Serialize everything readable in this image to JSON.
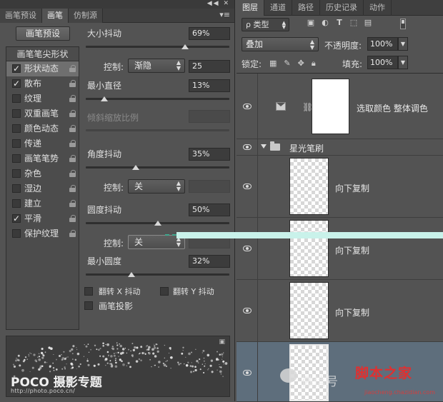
{
  "brush_panel": {
    "tabs": [
      "画笔预设",
      "画笔",
      "仿制源"
    ],
    "active_tab": 1,
    "preset_button": "画笔预设",
    "list_header": "画笔笔尖形状",
    "items": [
      {
        "label": "形状动态",
        "checked": true,
        "selected": true
      },
      {
        "label": "散布",
        "checked": true,
        "selected": false
      },
      {
        "label": "纹理",
        "checked": false,
        "selected": false
      },
      {
        "label": "双重画笔",
        "checked": false,
        "selected": false
      },
      {
        "label": "颜色动态",
        "checked": false,
        "selected": false
      },
      {
        "label": "传递",
        "checked": false,
        "selected": false
      },
      {
        "label": "画笔笔势",
        "checked": false,
        "selected": false
      },
      {
        "label": "杂色",
        "checked": false,
        "selected": false
      },
      {
        "label": "湿边",
        "checked": false,
        "selected": false
      },
      {
        "label": "建立",
        "checked": false,
        "selected": false
      },
      {
        "label": "平滑",
        "checked": true,
        "selected": false
      },
      {
        "label": "保护纹理",
        "checked": false,
        "selected": false
      }
    ],
    "size_jitter": {
      "label": "大小抖动",
      "value": "69%",
      "level": 0.69
    },
    "size_control": {
      "label": "控制:",
      "value": "渐隐",
      "number": "25"
    },
    "min_diameter": {
      "label": "最小直径",
      "value": "13%",
      "level": 0.13
    },
    "tilt_scale": {
      "label": "倾斜缩放比例"
    },
    "angle_jitter": {
      "label": "角度抖动",
      "value": "35%",
      "level": 0.35
    },
    "angle_control": {
      "label": "控制:",
      "value": "关"
    },
    "roundness_jitter": {
      "label": "圆度抖动",
      "value": "50%",
      "level": 0.5
    },
    "roundness_control": {
      "label": "控制:",
      "value": "关"
    },
    "min_roundness": {
      "label": "最小圆度",
      "value": "32%",
      "level": 0.32
    },
    "flip_x": "翻转 X 抖动",
    "flip_y": "翻转 Y 抖动",
    "brush_projection": "画笔投影",
    "watermark_logo": "POCO 摄影专题",
    "watermark_url": "http://photo.poco.cn/"
  },
  "layers_panel": {
    "tabs": [
      "图层",
      "通道",
      "路径",
      "历史记录",
      "动作"
    ],
    "active_tab": 0,
    "kind_filter": "ρ 类型",
    "blend_mode": "叠加",
    "opacity_label": "不透明度:",
    "opacity": "100%",
    "lock_label": "锁定:",
    "fill_label": "填充:",
    "fill": "100%",
    "layers": [
      {
        "name": "选取颜色 整体调色",
        "type": "adjustment"
      },
      {
        "name": "星光笔刷",
        "type": "group"
      },
      {
        "name": "向下复制",
        "type": "pixel"
      },
      {
        "name": "向下复制",
        "type": "pixel"
      },
      {
        "name": "向下复制",
        "type": "pixel"
      },
      {
        "name": "",
        "type": "pixel",
        "selected": true
      }
    ],
    "watermark_text": "微信号",
    "watermark_site": "脚本之家",
    "watermark_url": "jiaocheng.chazidian.com"
  }
}
